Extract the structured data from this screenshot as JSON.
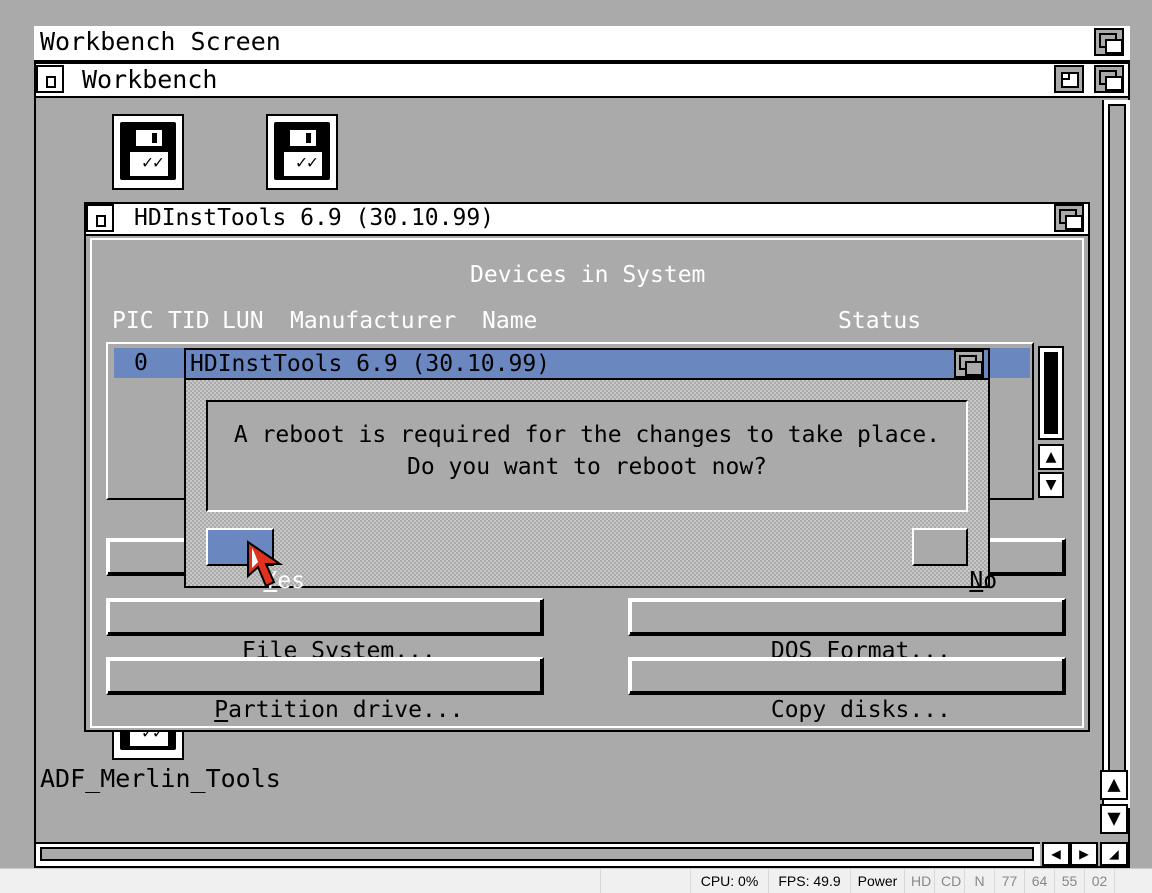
{
  "screen": {
    "title": "Workbench Screen"
  },
  "workbench": {
    "title": "Workbench",
    "icons": [
      {
        "label": "ADF_Merlin_Tools"
      }
    ]
  },
  "hdinst": {
    "title": "HDInstTools 6.9 (30.10.99)",
    "section_title": "Devices in System",
    "columns": {
      "pic": "PIC",
      "tid": "TID",
      "lun": "LUN",
      "manufacturer": "Manufacturer",
      "name": "Name",
      "status": "Status"
    },
    "devices": [
      {
        "pic": "0"
      }
    ],
    "buttons": {
      "file_system": {
        "hotkey": "F",
        "rest": "ile System..."
      },
      "dos_format": {
        "hotkey": "D",
        "rest": "OS Format..."
      },
      "partition": {
        "hotkey": "P",
        "rest": "artition drive..."
      },
      "copy": {
        "label": "Copy disks..."
      }
    }
  },
  "requester": {
    "title": "HDInstTools 6.9 (30.10.99)",
    "message_line1": "A reboot is required for the changes to take place.",
    "message_line2": "Do you want to reboot now?",
    "yes": {
      "hotkey": "Y",
      "rest": "es"
    },
    "no": {
      "hotkey": "N",
      "rest": "o"
    }
  },
  "status_bar": {
    "cpu": "CPU: 0%",
    "fps": "FPS: 49.9",
    "power": "Power",
    "hd": "HD",
    "cd": "CD",
    "n": "N",
    "d1": "77",
    "d2": "64",
    "d3": "55",
    "d4": "02"
  }
}
